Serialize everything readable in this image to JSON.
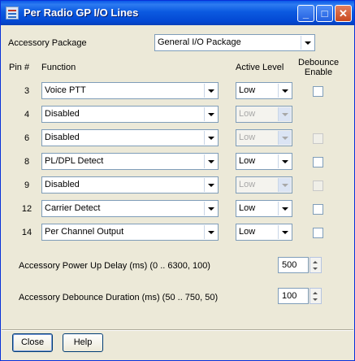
{
  "window": {
    "title": "Per Radio GP I/O Lines"
  },
  "titlebar_buttons": {
    "minimize": "_",
    "maximize": "□",
    "close": "✕"
  },
  "accessory": {
    "label": "Accessory Package",
    "value": "General I/O Package"
  },
  "headers": {
    "pin": "Pin #",
    "function": "Function",
    "active_level": "Active Level",
    "debounce": "Debounce Enable"
  },
  "rows": [
    {
      "pin": "3",
      "function": "Voice PTT",
      "level": "Low",
      "level_enabled": true,
      "debounce_visible": true,
      "debounce_checked": false
    },
    {
      "pin": "4",
      "function": "Disabled",
      "level": "Low",
      "level_enabled": false,
      "debounce_visible": false,
      "debounce_checked": false
    },
    {
      "pin": "6",
      "function": "Disabled",
      "level": "Low",
      "level_enabled": false,
      "debounce_visible": true,
      "debounce_checked": false
    },
    {
      "pin": "8",
      "function": "PL/DPL Detect",
      "level": "Low",
      "level_enabled": true,
      "debounce_visible": true,
      "debounce_checked": false
    },
    {
      "pin": "9",
      "function": "Disabled",
      "level": "Low",
      "level_enabled": false,
      "debounce_visible": true,
      "debounce_checked": false
    },
    {
      "pin": "12",
      "function": "Carrier Detect",
      "level": "Low",
      "level_enabled": true,
      "debounce_visible": true,
      "debounce_checked": false
    },
    {
      "pin": "14",
      "function": "Per Channel Output",
      "level": "Low",
      "level_enabled": true,
      "debounce_visible": true,
      "debounce_checked": false
    }
  ],
  "power_up_delay": {
    "label": "Accessory Power Up Delay (ms) (0 .. 6300, 100)",
    "value": "500"
  },
  "debounce_duration": {
    "label": "Accessory Debounce Duration (ms) (50 .. 750, 50)",
    "value": "100"
  },
  "buttons": {
    "close": "Close",
    "help": "Help"
  }
}
